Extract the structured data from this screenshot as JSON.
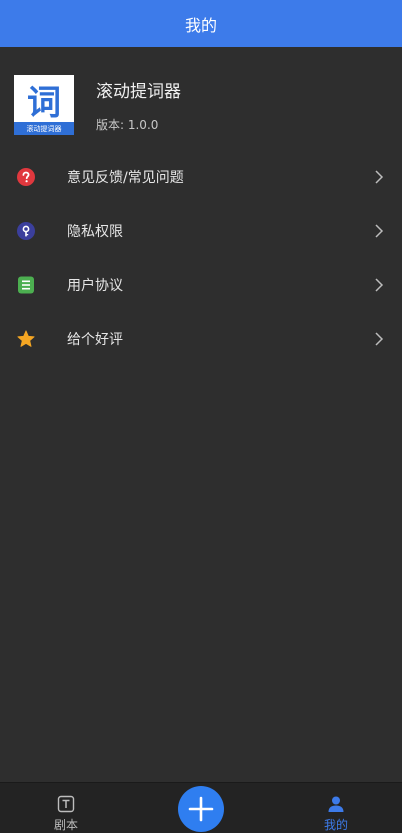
{
  "header": {
    "title": "我的"
  },
  "app": {
    "logo_glyph": "词",
    "logo_caption": "滚动提词器",
    "name": "滚动提词器",
    "version": "版本: 1.0.0"
  },
  "menu": {
    "items": [
      {
        "label": "意见反馈/常见问题",
        "icon": "question-icon",
        "icon_color": "#e0383e"
      },
      {
        "label": "隐私权限",
        "icon": "privacy-key-icon",
        "icon_color": "#3b3f9c"
      },
      {
        "label": "用户协议",
        "icon": "document-list-icon",
        "icon_color": "#4caf50"
      },
      {
        "label": "给个好评",
        "icon": "star-icon",
        "icon_color": "#f5a623"
      }
    ]
  },
  "tabbar": {
    "script_label": "剧本",
    "mine_label": "我的",
    "active_color": "#3d7bea"
  },
  "colors": {
    "header": "#3d7bea",
    "background": "#2e2e2e",
    "fab": "#2f7ef0"
  }
}
